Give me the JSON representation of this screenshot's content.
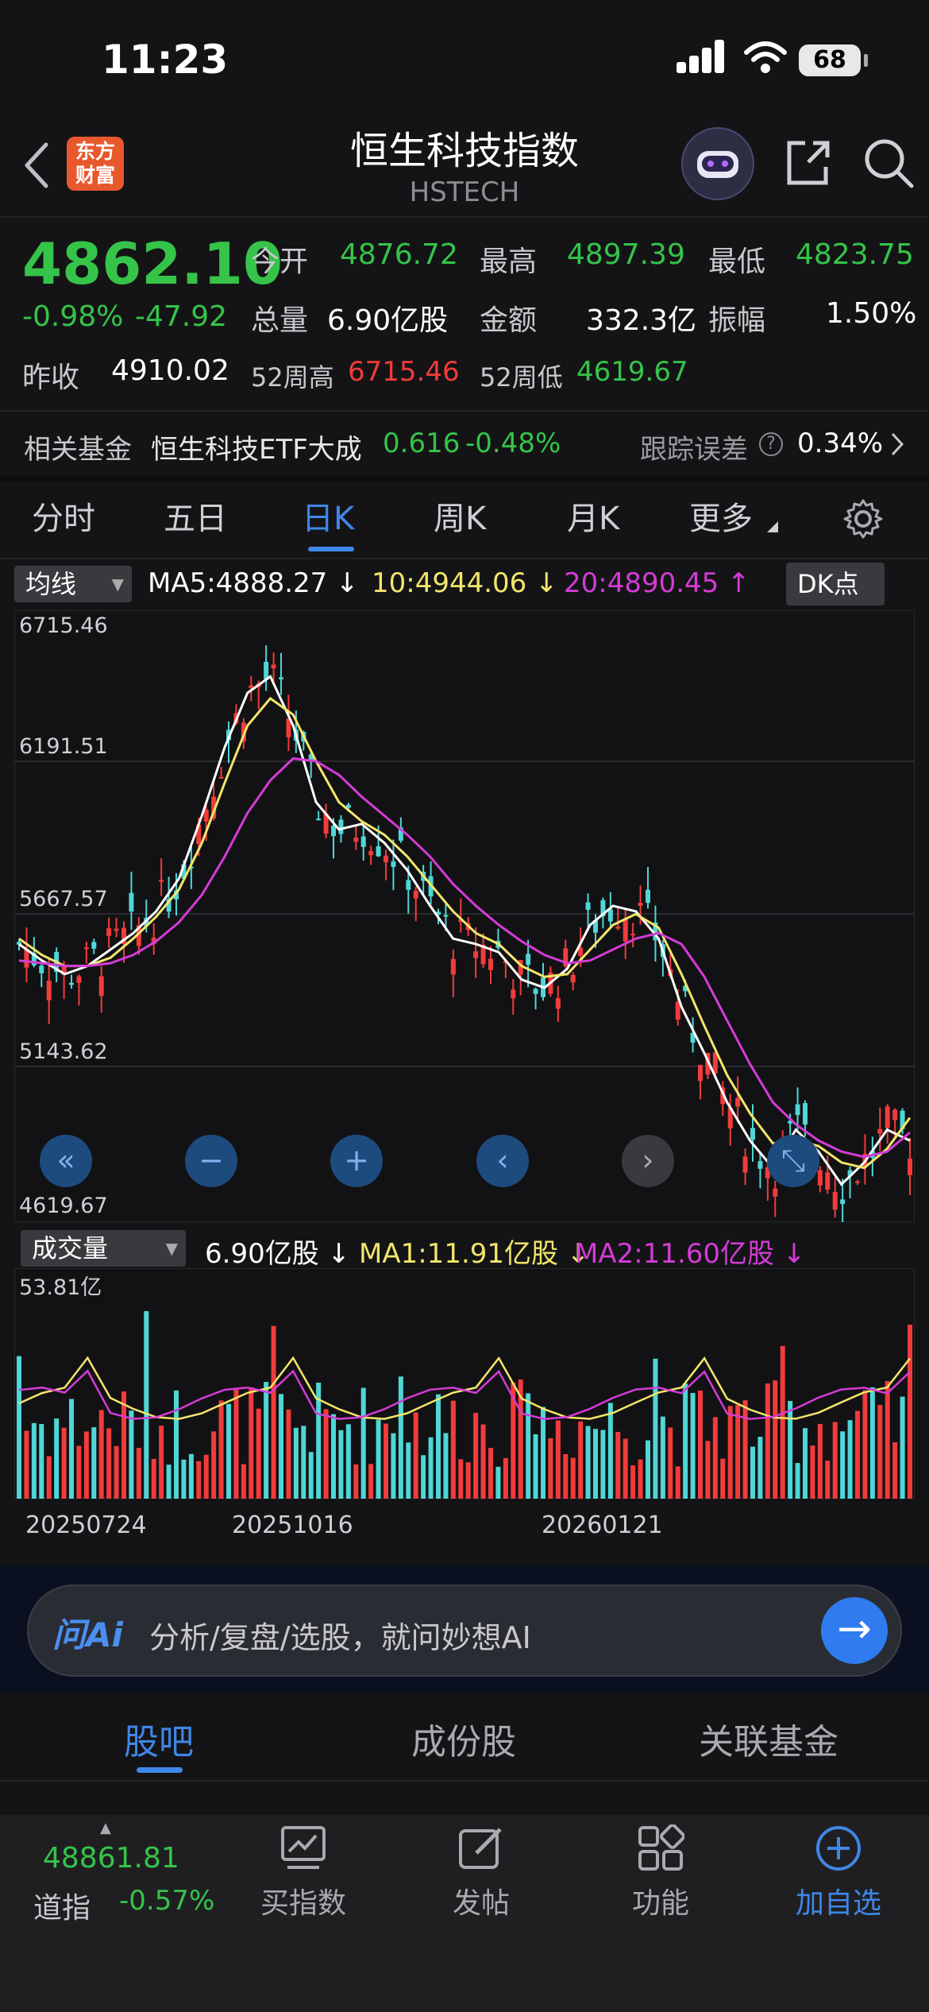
{
  "status_bar": {
    "time": "11:23",
    "battery": "68"
  },
  "header": {
    "title": "恒生科技指数",
    "subtitle": "HSTECH",
    "logo_text": "东方财富"
  },
  "quote": {
    "price": "4862.10",
    "change_pct": "-0.98%",
    "change_abs": "-47.92",
    "open_label": "今开",
    "open": "4876.72",
    "high_label": "最高",
    "high": "4897.39",
    "low_label": "最低",
    "low": "4823.75",
    "volume_label": "总量",
    "volume": "6.90亿股",
    "amount_label": "金额",
    "amount": "332.3亿",
    "amplitude_label": "振幅",
    "amplitude": "1.50%",
    "prev_close_label": "昨收",
    "prev_close": "4910.02",
    "w52_high_label": "52周高",
    "w52_high": "6715.46",
    "w52_low_label": "52周低",
    "w52_low": "4619.67"
  },
  "fund": {
    "label": "相关基金",
    "name": "恒生科技ETF大成",
    "price": "0.616",
    "change": "-0.48%",
    "tracking_label": "跟踪误差",
    "tracking_value": "0.34%"
  },
  "period_tabs": [
    "分时",
    "五日",
    "日K",
    "周K",
    "月K",
    "更多"
  ],
  "active_period": "日K",
  "kline_header": {
    "indicator": "均线",
    "ma5": "MA5:4888.27 ↓",
    "ma10": "10:4944.06 ↓",
    "ma20": "20:4890.45 ↑",
    "dk_button": "DK点"
  },
  "y_axis_labels": [
    "6715.46",
    "6191.51",
    "5667.57",
    "5143.62",
    "4619.67"
  ],
  "volume_header": {
    "indicator": "成交量",
    "value": "6.90亿股 ↓",
    "ma1": "MA1:11.91亿股 ↓",
    "ma2": "MA2:11.60亿股 ↓"
  },
  "volume_axis_top": "53.81亿",
  "x_axis_labels": [
    "20250724",
    "20251016",
    "20260121"
  ],
  "ai_bar": {
    "logo": "问Ai",
    "placeholder": "分析/复盘/选股，就问妙想AI"
  },
  "bottom_tabs": [
    "股吧",
    "成份股",
    "关联基金"
  ],
  "ticker": {
    "name": "道指",
    "value": "48861.81",
    "change": "-0.57%"
  },
  "nav": [
    "买指数",
    "发帖",
    "功能",
    "加自选"
  ],
  "colors": {
    "up": "#f23b3b",
    "down": "#35c449",
    "accent": "#3f87e8",
    "ma5": "#ffffff",
    "ma10": "#f3e56b",
    "ma20": "#d43bd6"
  },
  "chart_data": {
    "type": "candlestick",
    "y_range": [
      4619.67,
      6715.46
    ],
    "ma_series": [
      {
        "name": "MA5",
        "values": [
          5580,
          5520,
          5470,
          5500,
          5560,
          5620,
          5700,
          5820,
          6050,
          6300,
          6500,
          6560,
          6380,
          6100,
          6000,
          6020,
          5950,
          5850,
          5720,
          5600,
          5580,
          5550,
          5450,
          5420,
          5490,
          5650,
          5720,
          5700,
          5600,
          5350,
          5180,
          5000,
          4860,
          4760,
          4900,
          4820,
          4700,
          4780,
          4900,
          4860
        ]
      },
      {
        "name": "10",
        "values": [
          5600,
          5540,
          5500,
          5500,
          5530,
          5600,
          5680,
          5780,
          5950,
          6170,
          6380,
          6480,
          6420,
          6250,
          6100,
          6030,
          5980,
          5900,
          5800,
          5700,
          5620,
          5580,
          5500,
          5460,
          5470,
          5560,
          5650,
          5690,
          5640,
          5470,
          5280,
          5100,
          4960,
          4850,
          4860,
          4840,
          4780,
          4760,
          4830,
          4944
        ]
      },
      {
        "name": "20",
        "values": [
          5520,
          5510,
          5500,
          5500,
          5510,
          5540,
          5590,
          5660,
          5760,
          5900,
          6060,
          6180,
          6260,
          6250,
          6200,
          6120,
          6050,
          5980,
          5900,
          5800,
          5720,
          5650,
          5590,
          5540,
          5510,
          5520,
          5560,
          5600,
          5620,
          5580,
          5460,
          5300,
          5140,
          5000,
          4920,
          4860,
          4820,
          4800,
          4820,
          4890
        ]
      }
    ],
    "volume_axis_max": "53.81亿"
  }
}
